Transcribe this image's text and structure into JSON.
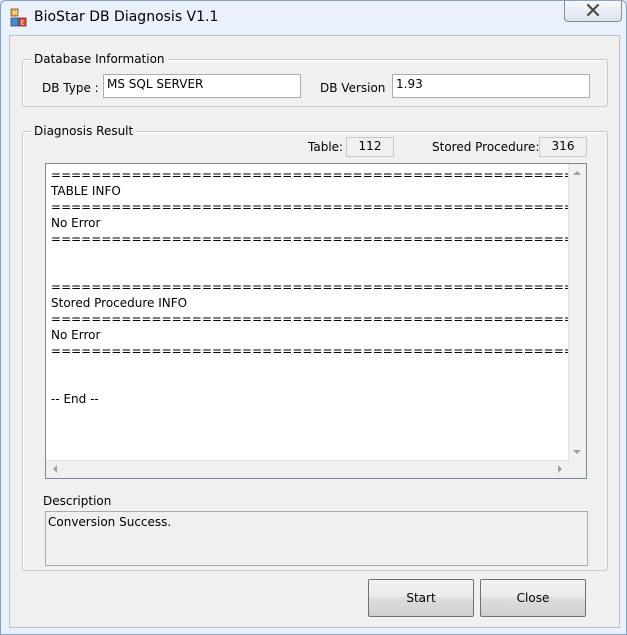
{
  "window": {
    "title": "BioStar DB Diagnosis V1.1",
    "icon": "app-blocks-icon",
    "close_icon": "close-icon"
  },
  "database_info": {
    "group_label": "Database Information",
    "db_type_label": "DB Type :",
    "db_type_value": "MS SQL SERVER",
    "db_version_label": "DB Version",
    "db_version_value": "1.93"
  },
  "diagnosis": {
    "group_label": "Diagnosis Result",
    "table_label": "Table:",
    "table_count": "112",
    "sp_label": "Stored Procedure:",
    "sp_count": "316",
    "log_text": "=========================================================\nTABLE INFO\n=========================================================\nNo Error\n=========================================================\n\n\n=========================================================\nStored Procedure INFO\n=========================================================\nNo Error\n=========================================================\n\n\n-- End --"
  },
  "description": {
    "label": "Description",
    "text": "Conversion Success."
  },
  "buttons": {
    "start": "Start",
    "close": "Close"
  }
}
